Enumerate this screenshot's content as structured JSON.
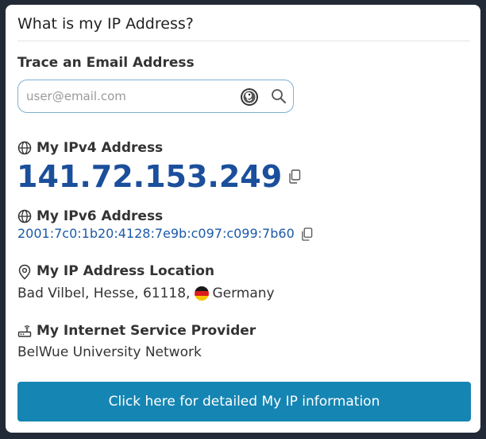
{
  "widget": {
    "title": "What is my IP Address?"
  },
  "trace": {
    "label": "Trace an Email Address",
    "placeholder": "user@email.com",
    "duck_icon": "duckduckgo-icon",
    "search_icon": "search-icon"
  },
  "ipv4": {
    "label": "My IPv4 Address",
    "value": "141.72.153.249",
    "icon": "globe-icon"
  },
  "ipv6": {
    "label": "My IPv6 Address",
    "value": "2001:7c0:1b20:4128:7e9b:c097:c099:7b60",
    "icon": "globe-icon"
  },
  "location": {
    "label": "My IP Address Location",
    "text": "Bad Vilbel, Hesse, 61118,",
    "country": "Germany",
    "icon": "map-pin-icon"
  },
  "isp": {
    "label": "My Internet Service Provider",
    "value": "BelWue University Network",
    "icon": "router-icon"
  },
  "cta": {
    "label": "Click here for detailed My IP information",
    "color": "#1585b3"
  },
  "colors": {
    "ipv4_value": "#1b4f9c",
    "ipv6_value": "#1b5aa8",
    "page_background": "#232a37"
  }
}
